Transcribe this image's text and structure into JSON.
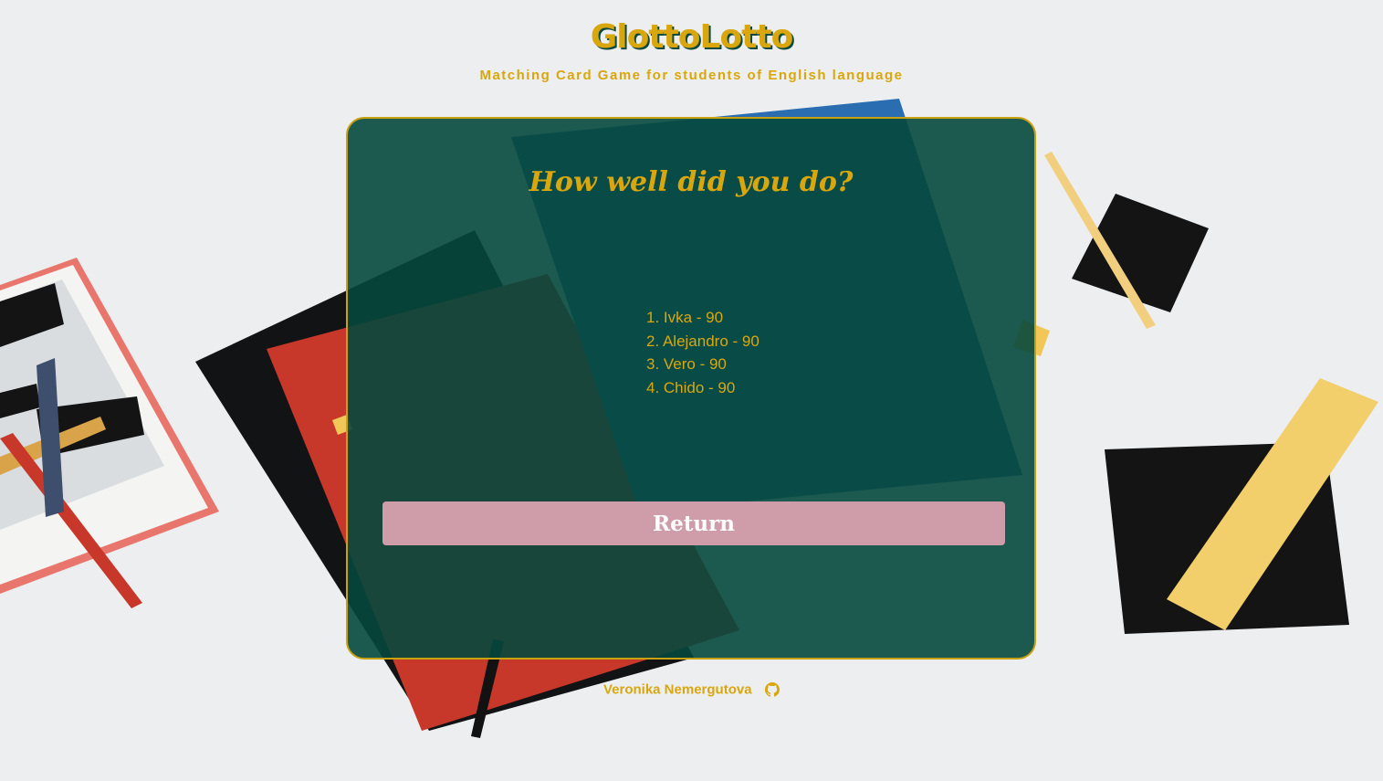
{
  "header": {
    "title": "GlottoLotto",
    "subtitle": "Matching Card Game for students of English language"
  },
  "panel": {
    "heading": "How well did you do?",
    "scores": [
      "1. Ivka - 90",
      "2. Alejandro - 90",
      "3. Vero - 90",
      "4. Chido - 90"
    ],
    "return_label": "Return"
  },
  "footer": {
    "author": "Veronika Nemergutova",
    "icon": "github-icon"
  },
  "colors": {
    "accent": "#d9a70d",
    "panel_bg": "#05483c",
    "button_bg": "#cf9ca9",
    "page_bg": "#ecedef"
  }
}
